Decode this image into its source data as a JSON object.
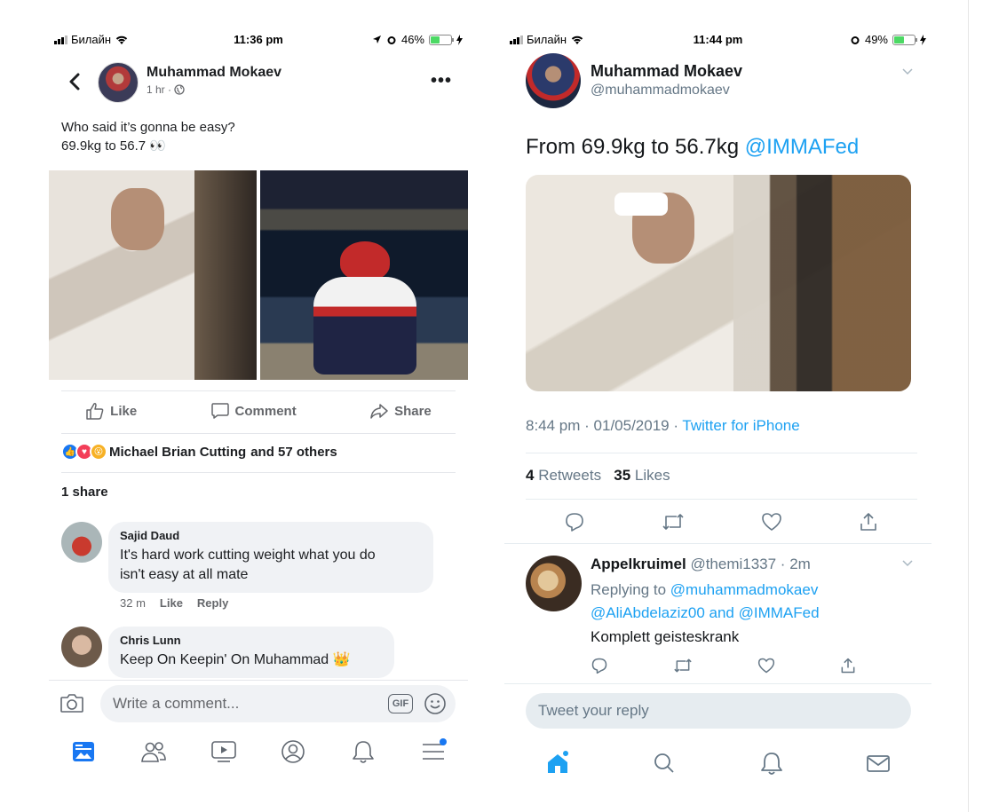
{
  "colors": {
    "fb_blue": "#1877f2",
    "tw_blue": "#1da1f2",
    "battery_green": "#4cd964"
  },
  "facebook": {
    "status": {
      "carrier": "Билайн",
      "time": "11:36 pm",
      "battery": "46%"
    },
    "post": {
      "author": "Muhammad Mokaev",
      "time": "1 hr · ",
      "text_line1": "Who said it’s gonna be easy?",
      "text_line2": "69.9kg to 56.7 👀"
    },
    "actions": {
      "like": "Like",
      "comment": "Comment",
      "share": "Share"
    },
    "reactions": {
      "names": "Michael Brian Cutting",
      "others": "and 57 others"
    },
    "shares": "1 share",
    "comments": [
      {
        "author": "Sajid Daud",
        "text_line1": "It's hard work cutting weight what you do",
        "text_line2": "isn't easy at all mate",
        "time": "32 m",
        "like": "Like",
        "reply": "Reply"
      },
      {
        "author": "Chris Lunn",
        "text": "Keep On Keepin' On Muhammad 👑"
      }
    ],
    "composer": {
      "placeholder": "Write a comment...",
      "gif": "GIF"
    },
    "nav_icons": [
      "news-feed-icon",
      "friends-icon",
      "watch-icon",
      "profile-icon",
      "notifications-icon",
      "menu-icon"
    ]
  },
  "twitter": {
    "status": {
      "carrier": "Билайн",
      "time": "11:44 pm",
      "battery": "49%"
    },
    "tweet": {
      "name": "Muhammad Mokaev",
      "handle": "@muhammadmokaev",
      "text": "From 69.9kg to 56.7kg ",
      "mention": "@IMMAFed",
      "timestamp": "8:44 pm · 01/05/2019 · ",
      "source": "Twitter for iPhone",
      "retweets": "4",
      "retweets_label": "Retweets",
      "likes": "35",
      "likes_label": "Likes"
    },
    "reply": {
      "name": "Appelkruimel",
      "handle_time": "@themi1337 · 2m",
      "replying_to": "Replying to ",
      "mention1": "@muhammadmokaev",
      "mention2": "@AliAbdelaziz00",
      "and": " and ",
      "mention3": "@IMMAFed",
      "text": "Komplett geisteskrank"
    },
    "composer": {
      "placeholder": "Tweet your reply"
    },
    "nav_icons": [
      "home-icon",
      "search-icon",
      "notifications-icon",
      "messages-icon"
    ]
  }
}
